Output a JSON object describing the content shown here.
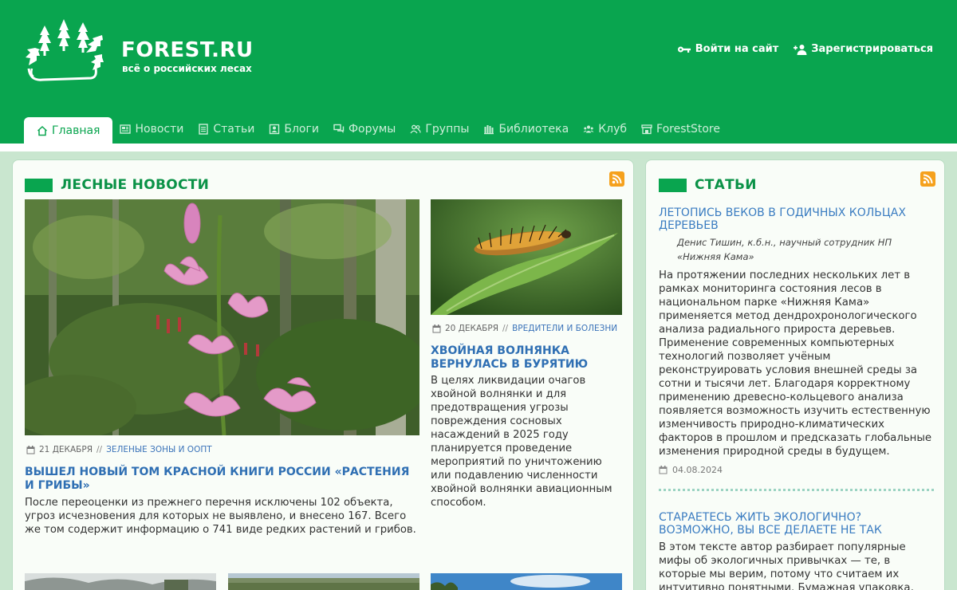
{
  "site": {
    "name": "FOREST.RU",
    "tagline": "всё о российских лесах"
  },
  "auth": {
    "login": "Войти на сайт",
    "register": "Зарегистрироваться"
  },
  "nav": [
    {
      "label": "Главная",
      "icon": "home-icon",
      "active": true
    },
    {
      "label": "Новости",
      "icon": "newspaper-icon"
    },
    {
      "label": "Статьи",
      "icon": "document-icon"
    },
    {
      "label": "Блоги",
      "icon": "user-card-icon"
    },
    {
      "label": "Форумы",
      "icon": "chat-icon"
    },
    {
      "label": "Группы",
      "icon": "users-icon"
    },
    {
      "label": "Библиотека",
      "icon": "library-icon"
    },
    {
      "label": "Клуб",
      "icon": "club-icon"
    },
    {
      "label": "ForestStore",
      "icon": "store-icon"
    }
  ],
  "news_section": {
    "title": "ЛЕСНЫЕ НОВОСТИ",
    "items": [
      {
        "date": "21 ДЕКАБРЯ",
        "separator": "//",
        "category": "ЗЕЛЕНЫЕ ЗОНЫ И ООПТ",
        "title": "ВЫШЕЛ НОВЫЙ ТОМ КРАСНОЙ КНИГИ РОССИИ «РАСТЕНИЯ И ГРИБЫ»",
        "text": "После переоценки из прежнего перечня исключены 102 объекта, угроз исчезновения для которых не выявлено, и внесено 167. Всего же том содержит информацию о 741 виде редких растений и грибов."
      },
      {
        "date": "20 ДЕКАБРЯ",
        "separator": "//",
        "category": "ВРЕДИТЕЛИ И БОЛЕЗНИ",
        "title": "ХВОЙНАЯ ВОЛНЯНКА ВЕРНУЛАСЬ В БУРЯТИЮ",
        "text": "В целях ликвидации очагов хвойной волнянки и для предотвращения угрозы повреждения сосновых насаждений в 2025 году планируется проведение мероприятий по уничтожению или подавлению численности хвойной волнянки авиационным способом."
      }
    ]
  },
  "articles_section": {
    "title": "СТАТЬИ",
    "items": [
      {
        "title": "ЛЕТОПИСЬ ВЕКОВ В ГОДИЧНЫХ КОЛЬЦАХ ДЕРЕВЬЕВ",
        "author": "Денис Тишин, к.б.н., научный сотрудник НП «Нижняя Кама»",
        "text": "На протяжении последних нескольких лет в рамках мониторинга состояния лесов в национальном парке «Нижняя Кама» применяется метод дендрохронологического анализа радиального прироста деревьев. Применение современных компьютерных технологий позволяет учёным реконструировать условия внешней среды за сотни и тысячи лет. Благодаря корректному применению древесно-кольцевого анализа появляется возможность изучить естественную изменчивость природно-климатических факторов в прошлом и предсказать глобальные изменения природной среды в будущем.",
        "date": "04.08.2024"
      },
      {
        "title": "СТАРАЕТЕСЬ ЖИТЬ ЭКОЛОГИЧНО? ВОЗМОЖНО, ВЫ ВСЕ ДЕЛАЕТЕ НЕ ТАК",
        "text": "В этом тексте автор разбирает популярные мифы об экологичных привычках — те, в которые мы верим, потому что считаем их интуитивно понятными. Бумажная упаковка,"
      }
    ]
  },
  "colors": {
    "brand_green": "#09a54f",
    "link_blue": "#2f6fb3",
    "rss_orange": "#f5a11d"
  }
}
